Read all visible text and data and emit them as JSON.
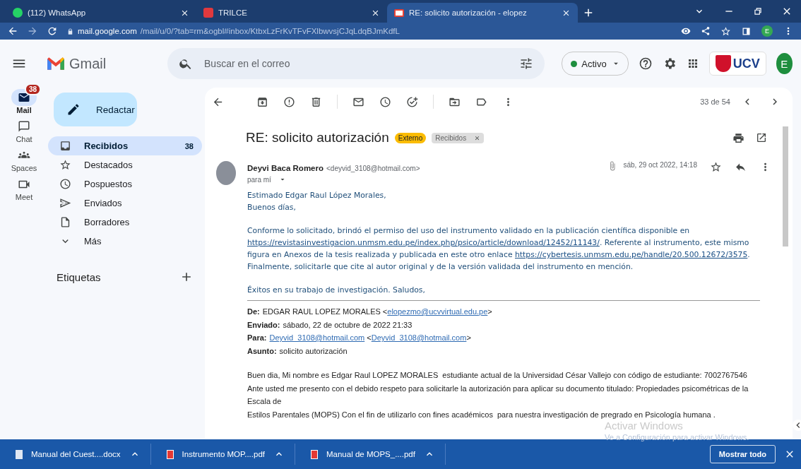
{
  "browser": {
    "tabs": [
      {
        "title": "(112) WhatsApp",
        "kind": "whatsapp",
        "selected": false
      },
      {
        "title": "TRILCE",
        "kind": "trilce",
        "selected": false
      },
      {
        "title": "RE: solicito autorización - elopez",
        "kind": "gmail",
        "selected": true
      }
    ],
    "address": {
      "host": "mail.google.com",
      "path": "/mail/u/0/?tab=rm&ogbl#inbox/KtbxLzFrKvTFvFXlbwvsjCJqLdqBJmKdfL"
    },
    "profile": "E"
  },
  "gmail": {
    "logo": "Gmail",
    "search": {
      "placeholder": "Buscar en el correo"
    },
    "status": "Activo",
    "org_logo": "UCV",
    "avatar": "E"
  },
  "rail": [
    {
      "label": "Mail",
      "kind": "mail",
      "selected": true,
      "badge": "38"
    },
    {
      "label": "Chat",
      "kind": "chat",
      "selected": false
    },
    {
      "label": "Spaces",
      "kind": "spaces",
      "selected": false
    },
    {
      "label": "Meet",
      "kind": "meet",
      "selected": false
    }
  ],
  "compose": "Redactar",
  "folders": [
    {
      "label": "Recibidos",
      "kind": "inbox",
      "count": "38",
      "selected": true
    },
    {
      "label": "Destacados",
      "kind": "star",
      "selected": false
    },
    {
      "label": "Pospuestos",
      "kind": "clock",
      "selected": false
    },
    {
      "label": "Enviados",
      "kind": "send",
      "selected": false
    },
    {
      "label": "Borradores",
      "kind": "draft",
      "selected": false
    },
    {
      "label": "Más",
      "kind": "more",
      "selected": false
    }
  ],
  "labels_heading": "Etiquetas",
  "toolbar": {
    "counter": "33 de 54"
  },
  "message": {
    "subject": "RE: solicito autorización",
    "tags": [
      {
        "label": "Externo",
        "kind": "external"
      },
      {
        "label": "Recibidos",
        "kind": "label"
      }
    ],
    "sender": "Deyvi Baca Romero",
    "sender_email": "<deyvid_3108@hotmail.com>",
    "recipient": "para mí",
    "date": "sáb, 29 oct 2022, 14:18",
    "body": [
      [
        [
          {
            "text": "Estimado Edgar Raul López Morales,"
          }
        ],
        [
          {
            "text": "Buenos días,"
          }
        ]
      ],
      [
        [
          {
            "text": "Conforme lo solicitado, brindó el permiso del uso del instrumento validado en la publicación científica disponible en "
          },
          {
            "link": "https://revistasinvestigacion.unmsm.edu.pe/index.php/psico/article/download/12452/11143/"
          },
          {
            "text": ". Referente al instrumento, este mismo figura en Anexos de la tesis realizada y publicada en este otro enlace "
          },
          {
            "link": "https://cybertesis.unmsm.edu.pe/handle/20.500.12672/3575"
          },
          {
            "text": ". Finalmente, solicitarle que cite al autor original y de la versión validada del instrumento en mención."
          }
        ]
      ],
      [
        [
          {
            "text": "Éxitos en su trabajo de investigación. Saludos,"
          }
        ]
      ]
    ],
    "quoted_header": [
      [
        {
          "label": "De:"
        },
        {
          "text": "EDGAR RAUL LOPEZ MORALES <"
        },
        {
          "link": "elopezmo@ucvvirtual.edu.pe"
        },
        {
          "text": ">"
        }
      ],
      [
        {
          "label": "Enviado:"
        },
        {
          "text": "sábado, 22 de octubre de 2022 21:33"
        }
      ],
      [
        {
          "label": "Para:"
        },
        {
          "link": "Deyvid_3108@hotmail.com"
        },
        {
          "text": " <"
        },
        {
          "link": "Deyvid_3108@hotmail.com"
        },
        {
          "text": ">"
        }
      ],
      [
        {
          "label": "Asunto:"
        },
        {
          "text": "solicito autorización"
        }
      ]
    ],
    "quoted_body": [
      "Buen dia, Mi nombre es Edgar Raul LOPEZ MORALES  estudiante actual de la Universidad César Vallejo con código de estudiante: 7002767546",
      "Ante usted me presento con el debido respeto para solicitarle la autorización para aplicar su documento titulado: Propiedades psicométricas de la",
      "Escala de",
      "Estilos Parentales (MOPS) Con el fin de utilizarlo con fines académicos  para nuestra investigación de pregrado en Psicología humana ."
    ]
  },
  "downloads": [
    {
      "name": "Manual del Cuest....docx",
      "kind": "docx"
    },
    {
      "name": "Instrumento MOP....pdf",
      "kind": "pdf"
    },
    {
      "name": "Manual de MOPS_....pdf",
      "kind": "pdf"
    }
  ],
  "show_all": "Mostrar todo",
  "activation_notice": {
    "title": "Activar Windows",
    "detail": "Ve a Configuración para activar Windows."
  }
}
